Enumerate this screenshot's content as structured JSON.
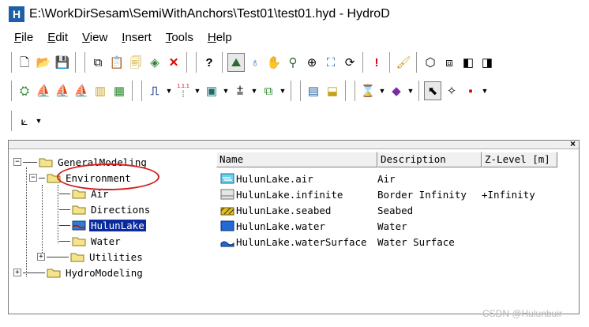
{
  "window": {
    "title": "E:\\WorkDirSesam\\SemiWithAnchors\\Test01\\test01.hyd - HydroD",
    "app_icon_letter": "H"
  },
  "menu": [
    {
      "accel": "F",
      "rest": "ile"
    },
    {
      "accel": "E",
      "rest": "dit"
    },
    {
      "accel": "V",
      "rest": "iew"
    },
    {
      "accel": "I",
      "rest": "nsert"
    },
    {
      "accel": "T",
      "rest": "ools"
    },
    {
      "accel": "H",
      "rest": "elp"
    }
  ],
  "toolbar": {
    "new_glyph": "🗋",
    "open_glyph": "📂",
    "save_glyph": "💾",
    "copy_glyph": "⧉",
    "paste_glyph": "📋",
    "props_glyph": "🗐",
    "layers_glyph": "◈",
    "delete_glyph": "✕",
    "help_glyph": "?",
    "select_glyph": "⛰",
    "pick_glyph": "♁",
    "pan_glyph": "✋",
    "zoom_glyph": "⚲",
    "zoomwin_glyph": "⊕",
    "fit_glyph": "⛶",
    "rotate_glyph": "⟳",
    "alert_glyph": "!",
    "brush_glyph": "🖌",
    "cube_glyph": "⬡",
    "cube2_glyph": "⧈",
    "cube3_glyph": "◧",
    "cube4_glyph": "◨",
    "r2_glyphs": [
      "⛭",
      "⛵",
      "⛵",
      "⛵",
      "▥",
      "▦",
      "⎍",
      "⁞",
      "▣",
      "⩲",
      "⧉",
      "▤",
      "⬓",
      "⌛",
      "◆",
      "⬉",
      "✧",
      "▪"
    ],
    "label_111": "1.1.1",
    "axis_glyph": "⟀"
  },
  "panel": {
    "close_glyph": "×"
  },
  "tree": {
    "general": "GeneralModeling",
    "environment": "Environment",
    "air": "Air",
    "directions": "Directions",
    "hulunlake": "HulunLake",
    "water": "Water",
    "utilities": "Utilities",
    "hydro": "HydroModeling",
    "minus": "−",
    "plus": "+"
  },
  "list": {
    "headers": [
      "Name",
      "Description",
      "Z-Level [m]"
    ],
    "rows": [
      {
        "name": "HulunLake.air",
        "desc": "Air",
        "z": ""
      },
      {
        "name": "HulunLake.infinite",
        "desc": "Border Infinity",
        "z": "+Infinity"
      },
      {
        "name": "HulunLake.seabed",
        "desc": "Seabed",
        "z": ""
      },
      {
        "name": "HulunLake.water",
        "desc": "Water",
        "z": ""
      },
      {
        "name": "HulunLake.waterSurface",
        "desc": "Water Surface",
        "z": ""
      }
    ]
  },
  "watermark": "CSDN @Hulunbuir",
  "colors": {
    "selection": "#0a2a9e",
    "folder": "#f5e48c",
    "annotation": "#d21d1d"
  }
}
